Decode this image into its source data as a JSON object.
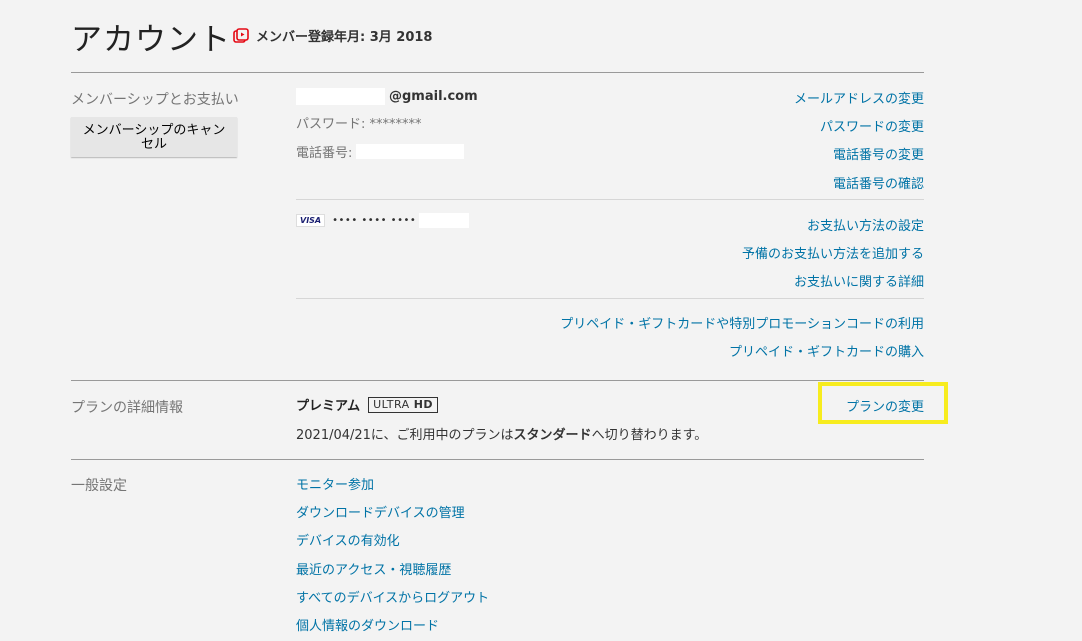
{
  "header": {
    "title": "アカウント",
    "member_since": "メンバー登録年月: 3月 2018"
  },
  "membership": {
    "section_label": "メンバーシップとお支払い",
    "cancel_button": "メンバーシップのキャンセル",
    "email_suffix": "@gmail.com",
    "password_label": "パスワード: ********",
    "phone_label": "電話番号:",
    "links": {
      "change_email": "メールアドレスの変更",
      "change_password": "パスワードの変更",
      "change_phone": "電話番号の変更",
      "verify_phone": "電話番号の確認"
    },
    "card": {
      "brand": "VISA",
      "masked": "•••• •••• ••••"
    },
    "payment_links": {
      "payment_settings": "お支払い方法の設定",
      "add_backup": "予備のお支払い方法を追加する",
      "billing_details": "お支払いに関する詳細"
    },
    "gift_links": {
      "redeem": "プリペイド・ギフトカードや特別プロモーションコードの利用",
      "buy": "プリペイド・ギフトカードの購入"
    }
  },
  "plan": {
    "section_label": "プランの詳細情報",
    "name": "プレミアム",
    "badge_light": "ULTRA",
    "badge_bold": "HD",
    "note_prefix": "2021/04/21に、ご利用中のプランは",
    "note_plan": "スタンダード",
    "note_suffix": "へ切り替わります。",
    "change_link": "プランの変更"
  },
  "settings": {
    "section_label": "一般設定",
    "items": [
      "モニター参加",
      "ダウンロードデバイスの管理",
      "デバイスの有効化",
      "最近のアクセス・視聴履歴",
      "すべてのデバイスからログアウト",
      "個人情報のダウンロード"
    ]
  },
  "colors": {
    "link": "#0073a6",
    "highlight": "#f7ec1e",
    "icon_red": "#e50914"
  }
}
